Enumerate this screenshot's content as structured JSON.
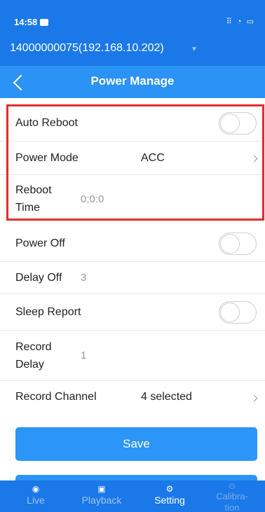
{
  "status_bar": {
    "time": "14:58",
    "icons": "⠿ ◔ ▭"
  },
  "device_bar": {
    "device": "14000000075(192.168.10.202)",
    "dropdown": "▼"
  },
  "title_bar": {
    "title": "Power Manage"
  },
  "settings": {
    "auto_reboot": {
      "label": "Auto Reboot",
      "on": false
    },
    "power_mode": {
      "label": "Power Mode",
      "value": "ACC"
    },
    "reboot_time": {
      "label_line1": "Reboot",
      "label_line2": "Time",
      "value": "0:0:0"
    },
    "power_off": {
      "label": "Power Off",
      "on": false
    },
    "delay_off": {
      "label": "Delay Off",
      "value": "3"
    },
    "sleep_report": {
      "label": "Sleep Report",
      "on": false
    },
    "record_delay": {
      "label_line1": "Record",
      "label_line2": "Delay",
      "value": "1"
    },
    "record_channel": {
      "label": "Record Channel",
      "value": "4 selected"
    }
  },
  "buttons": {
    "save": "Save"
  },
  "tabs": [
    {
      "label": "Live",
      "icon": "live-icon"
    },
    {
      "label": "Playback",
      "icon": "playback-icon"
    },
    {
      "label": "Setting",
      "icon": "gear-icon"
    },
    {
      "label_line1": "Calibra-",
      "label_line2": "tion",
      "icon": "calibration-icon"
    }
  ],
  "colors": {
    "primary": "#1a78e8",
    "button": "#2b96f7",
    "highlight": "#e32c2c"
  }
}
